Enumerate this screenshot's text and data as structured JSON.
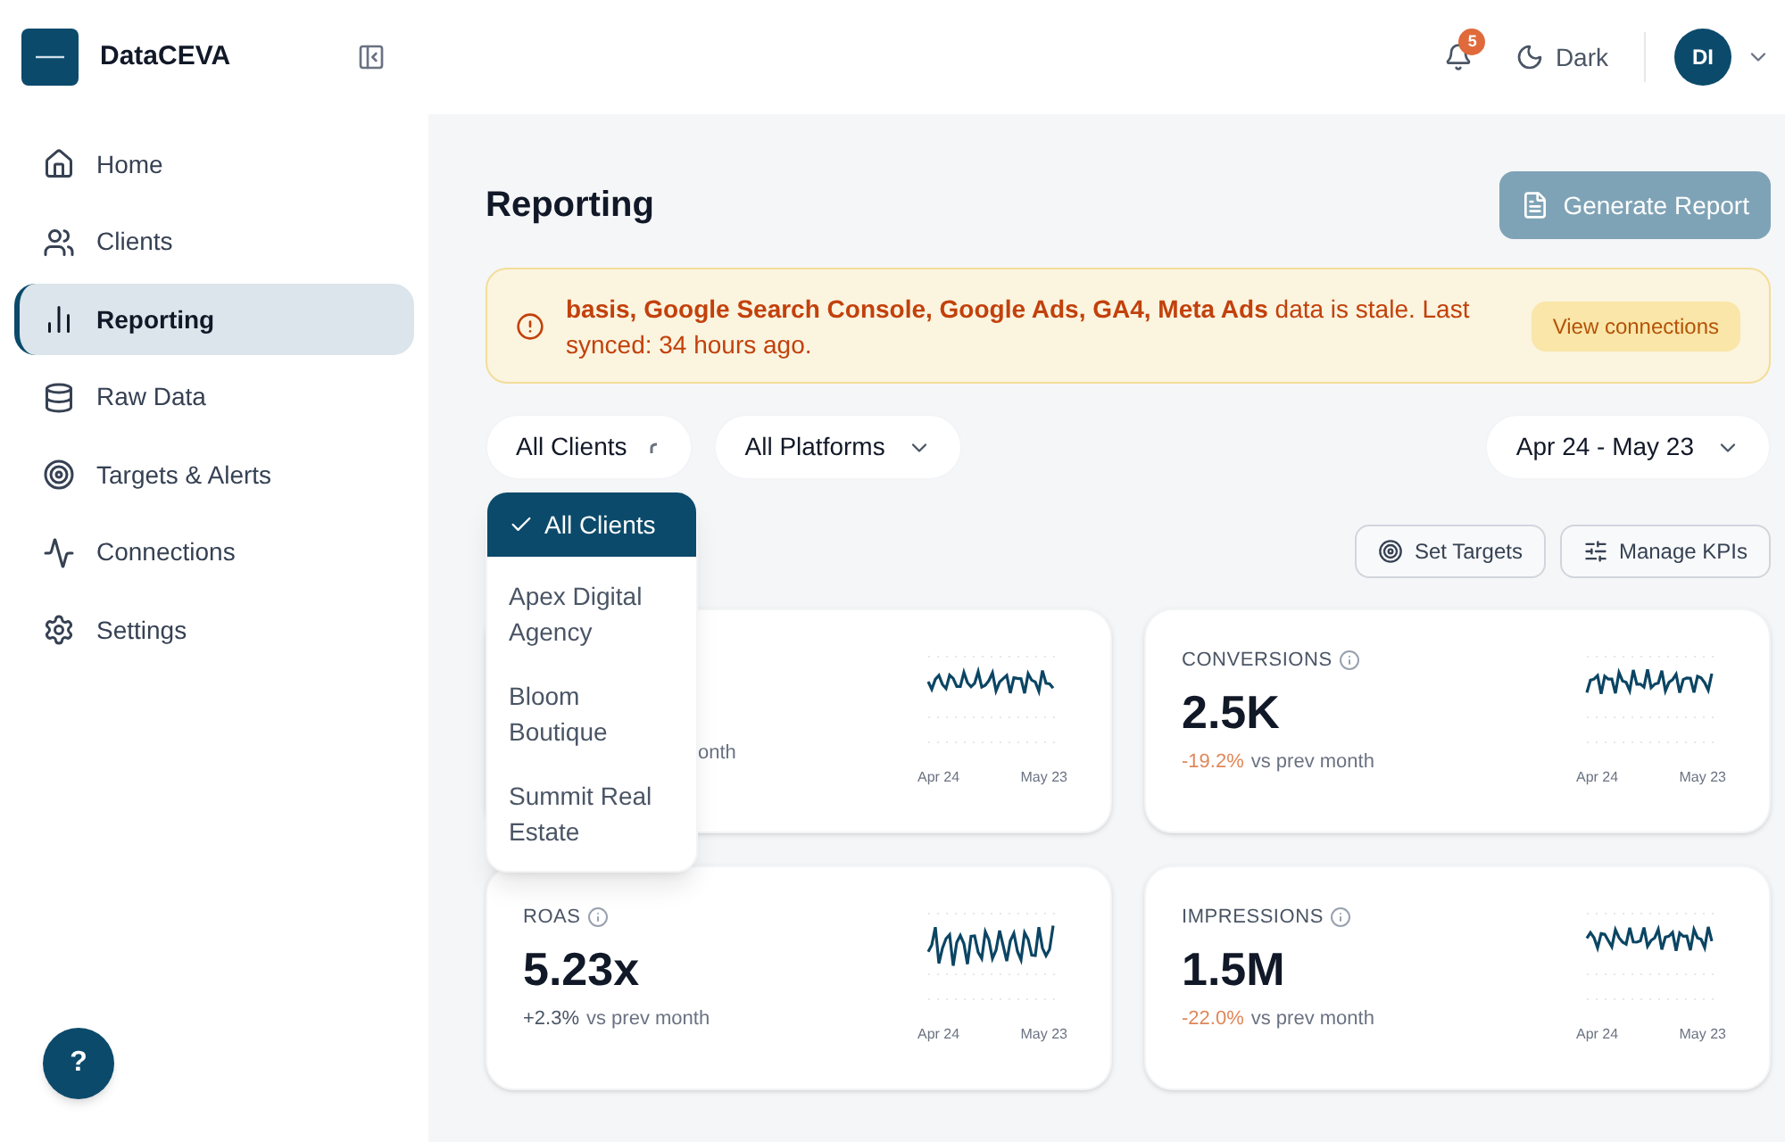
{
  "brand": {
    "name": "DataCEVA"
  },
  "header": {
    "notifications": "5",
    "theme": "Dark",
    "avatar": "DI"
  },
  "sidebar": {
    "items": [
      {
        "label": "Home",
        "selected": false
      },
      {
        "label": "Clients",
        "selected": false
      },
      {
        "label": "Reporting",
        "selected": true
      },
      {
        "label": "Raw Data",
        "selected": false
      },
      {
        "label": "Targets & Alerts",
        "selected": false
      },
      {
        "label": "Connections",
        "selected": false
      },
      {
        "label": "Settings",
        "selected": false
      }
    ],
    "help": "?"
  },
  "page": {
    "title": "Reporting",
    "action": "Generate Report",
    "action_disabled": true
  },
  "alert": {
    "text": "**basis, Google Search Console, Google Ads, GA4, Meta Ads** data is stale. Last synced: 34 hours ago.",
    "button": "View connections"
  },
  "filters": {
    "client": "All Clients",
    "platform": "All Platforms",
    "date_range": "Apr 24 - May 23"
  },
  "client_menu": [
    {
      "label": "All Clients",
      "selected": true
    },
    {
      "label": "Apex Digital Agency",
      "selected": false
    },
    {
      "label": "Bloom Boutique",
      "selected": false
    },
    {
      "label": "Summit Real Estate",
      "selected": false
    }
  ],
  "toolbar": [
    "Set Targets",
    "Manage KPIs"
  ],
  "covered_card": {
    "compare_tail": "onth",
    "x_start": "Apr 24",
    "x_end": "May 23"
  },
  "cards": [
    {
      "label": "CONVERSIONS",
      "value": "2.5K",
      "delta": "-19.2%",
      "kind": "decrease",
      "compare": "vs prev month",
      "x_start": "Apr 24",
      "x_end": "May 23"
    },
    {
      "label": "ROAS",
      "value": "5.23x",
      "delta": "+2.3%",
      "kind": "increase",
      "compare": "vs prev month",
      "x_start": "Apr 24",
      "x_end": "May 23"
    },
    {
      "label": "IMPRESSIONS",
      "value": "1.5M",
      "delta": "-22.0%",
      "kind": "decrease",
      "compare": "vs prev month",
      "x_start": "Apr 24",
      "x_end": "May 23"
    }
  ]
}
